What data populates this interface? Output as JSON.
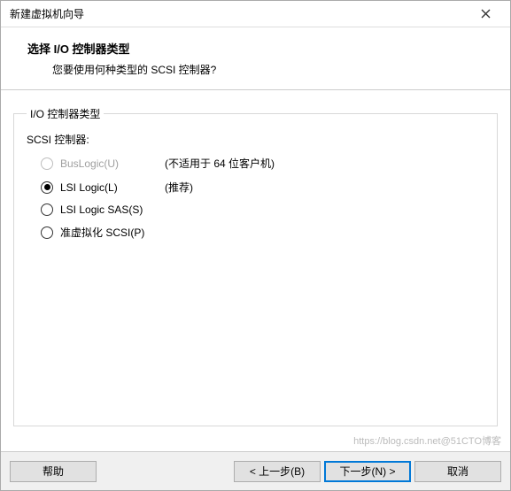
{
  "window": {
    "title": "新建虚拟机向导"
  },
  "header": {
    "main_title": "选择 I/O 控制器类型",
    "subtitle": "您要使用何种类型的 SCSI 控制器?"
  },
  "group": {
    "legend": "I/O 控制器类型",
    "subhead": "SCSI 控制器:",
    "options": [
      {
        "label": "BusLogic(U)",
        "note": "(不适用于 64 位客户机)",
        "disabled": true,
        "selected": false
      },
      {
        "label": "LSI Logic(L)",
        "note": "(推荐)",
        "disabled": false,
        "selected": true
      },
      {
        "label": "LSI Logic SAS(S)",
        "note": "",
        "disabled": false,
        "selected": false
      },
      {
        "label": "准虚拟化 SCSI(P)",
        "note": "",
        "disabled": false,
        "selected": false
      }
    ]
  },
  "footer": {
    "help": "帮助",
    "back": "< 上一步(B)",
    "next": "下一步(N) >",
    "cancel": "取消"
  },
  "watermark": "https://blog.csdn.net@51CTO博客"
}
